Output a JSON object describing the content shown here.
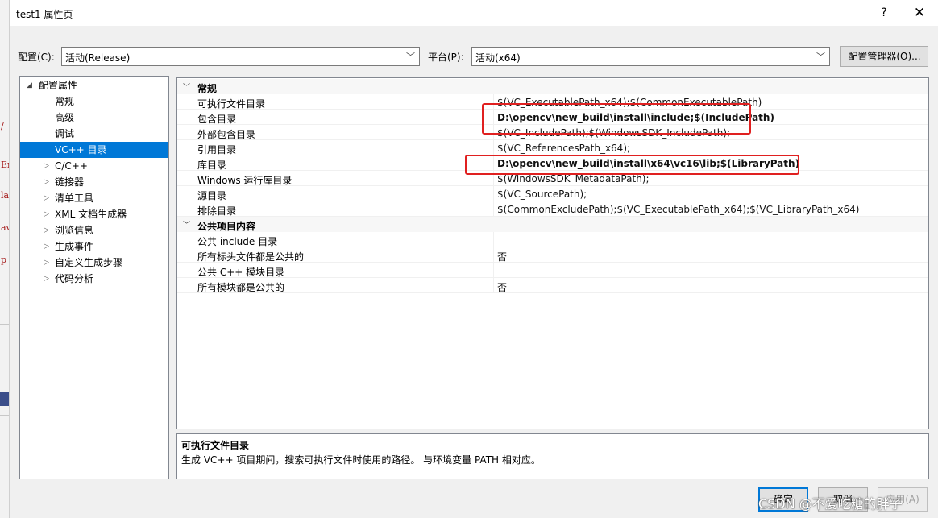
{
  "background": {
    "fragments": [
      "/",
      "En",
      "la",
      "av",
      "p"
    ]
  },
  "window": {
    "title": "test1 属性页",
    "help": "?",
    "close": "✕"
  },
  "toolbar": {
    "config_label": "配置(C):",
    "config_value": "活动(Release)",
    "platform_label": "平台(P):",
    "platform_value": "活动(x64)",
    "config_manager": "配置管理器(O)..."
  },
  "tree": {
    "root": "配置属性",
    "items": [
      {
        "label": "常规",
        "expandable": false,
        "selected": false
      },
      {
        "label": "高级",
        "expandable": false,
        "selected": false
      },
      {
        "label": "调试",
        "expandable": false,
        "selected": false
      },
      {
        "label": "VC++ 目录",
        "expandable": false,
        "selected": true
      },
      {
        "label": "C/C++",
        "expandable": true,
        "selected": false
      },
      {
        "label": "链接器",
        "expandable": true,
        "selected": false
      },
      {
        "label": "清单工具",
        "expandable": true,
        "selected": false
      },
      {
        "label": "XML 文档生成器",
        "expandable": true,
        "selected": false
      },
      {
        "label": "浏览信息",
        "expandable": true,
        "selected": false
      },
      {
        "label": "生成事件",
        "expandable": true,
        "selected": false
      },
      {
        "label": "自定义生成步骤",
        "expandable": true,
        "selected": false
      },
      {
        "label": "代码分析",
        "expandable": true,
        "selected": false
      }
    ]
  },
  "grid": {
    "categories": [
      {
        "name": "常规",
        "rows": [
          {
            "name": "可执行文件目录",
            "value": "$(VC_ExecutablePath_x64);$(CommonExecutablePath)",
            "bold": false
          },
          {
            "name": "包含目录",
            "value": "D:\\opencv\\new_build\\install\\include;$(IncludePath)",
            "bold": true
          },
          {
            "name": "外部包含目录",
            "value": "$(VC_IncludePath);$(WindowsSDK_IncludePath);",
            "bold": false
          },
          {
            "name": "引用目录",
            "value": "$(VC_ReferencesPath_x64);",
            "bold": false
          },
          {
            "name": "库目录",
            "value": "D:\\opencv\\new_build\\install\\x64\\vc16\\lib;$(LibraryPath)",
            "bold": true
          },
          {
            "name": "Windows 运行库目录",
            "value": "$(WindowsSDK_MetadataPath);",
            "bold": false
          },
          {
            "name": "源目录",
            "value": "$(VC_SourcePath);",
            "bold": false
          },
          {
            "name": "排除目录",
            "value": "$(CommonExcludePath);$(VC_ExecutablePath_x64);$(VC_LibraryPath_x64)",
            "bold": false
          }
        ]
      },
      {
        "name": "公共项目内容",
        "rows": [
          {
            "name": "公共 include 目录",
            "value": "",
            "bold": false
          },
          {
            "name": "所有标头文件都是公共的",
            "value": "否",
            "bold": false
          },
          {
            "name": "公共 C++ 模块目录",
            "value": "",
            "bold": false
          },
          {
            "name": "所有模块都是公共的",
            "value": "否",
            "bold": false
          }
        ]
      }
    ]
  },
  "description": {
    "title": "可执行文件目录",
    "text": "生成 VC++ 项目期间，搜索可执行文件时使用的路径。 与环境变量 PATH 相对应。"
  },
  "buttons": {
    "ok": "确定",
    "cancel": "取消",
    "apply": "应用(A)"
  },
  "watermark": "CSDN @不爱吃糖的胖子",
  "colors": {
    "selection": "#0078d7",
    "highlight": "#e02020"
  }
}
